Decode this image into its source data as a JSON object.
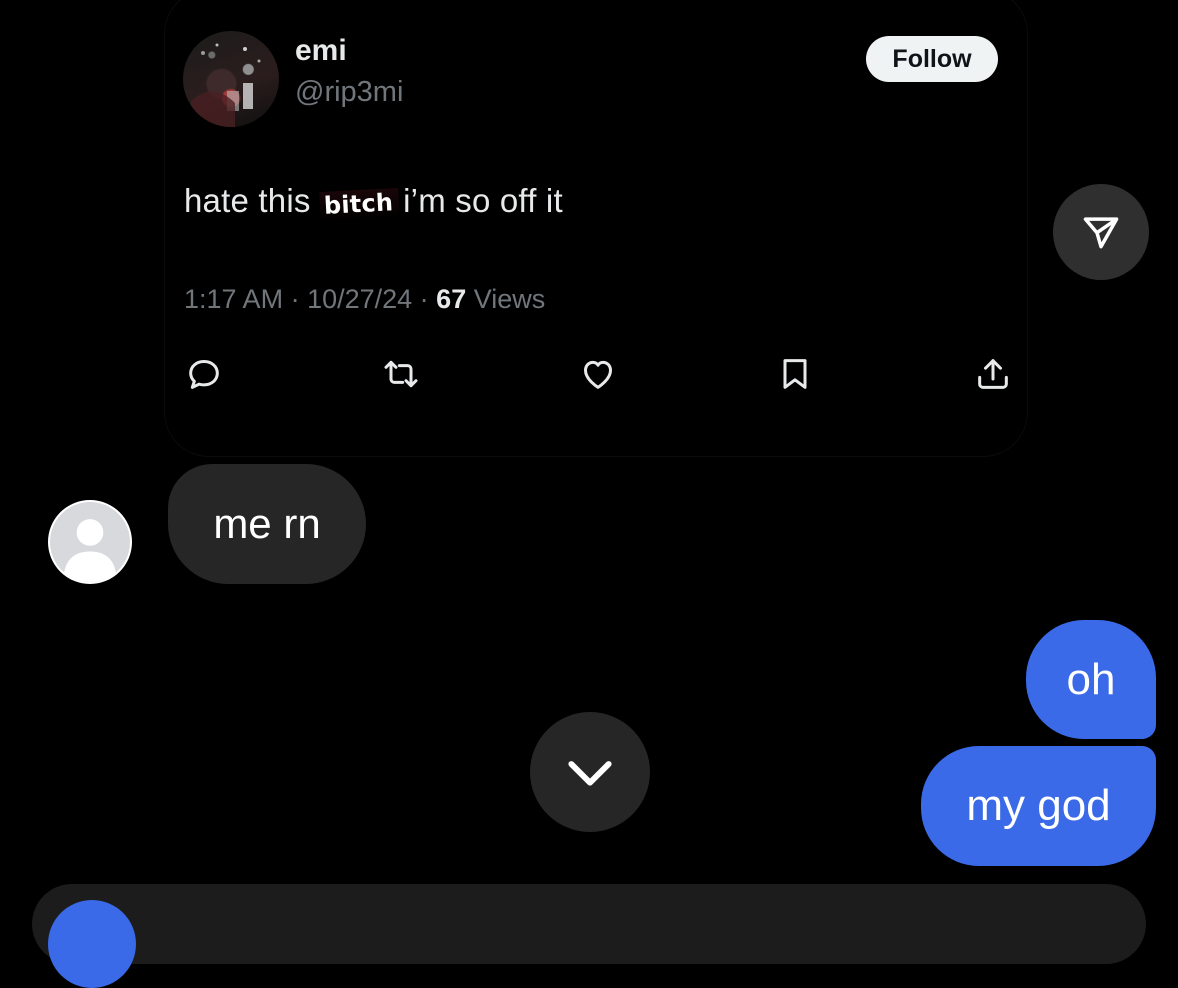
{
  "tweet": {
    "author_name": "emi",
    "author_handle": "@rip3mi",
    "follow_label": "Follow",
    "text_before": "hate this ",
    "text_sticker": "bitch",
    "text_after": "i’m so off it",
    "time": "1:17 AM",
    "date": "10/27/24",
    "separator": " · ",
    "views_count": "67",
    "views_label": " Views",
    "actions": [
      "reply-icon",
      "retweet-icon",
      "like-icon",
      "bookmark-icon",
      "share-icon"
    ]
  },
  "share_dm": {
    "icon": "paper-plane-icon"
  },
  "messages": {
    "incoming": [
      {
        "text": "me rn"
      }
    ],
    "outgoing": [
      {
        "text": "oh"
      },
      {
        "text": "my god"
      }
    ]
  },
  "scroll_down": {
    "icon": "chevron-down-icon"
  },
  "colors": {
    "background": "#000000",
    "incoming_bubble": "#262626",
    "outgoing_bubble": "#3a6ae8",
    "follow_button": "#eff3f4",
    "secondary_text": "#71767b"
  }
}
